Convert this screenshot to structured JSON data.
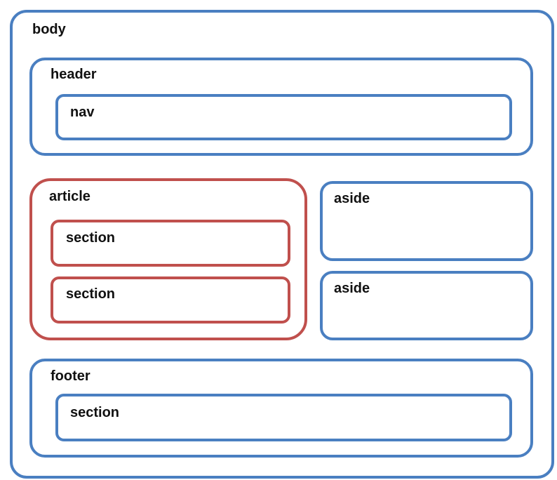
{
  "colors": {
    "blue_border": "#4a7fc1",
    "red_border": "#c0504d",
    "frame": "#000000",
    "background": "#ffffff"
  },
  "labels": {
    "body": "body",
    "header": "header",
    "nav": "nav",
    "article": "article",
    "section_1": "section",
    "section_2": "section",
    "aside_1": "aside",
    "aside_2": "aside",
    "footer": "footer",
    "footer_section": "section"
  }
}
